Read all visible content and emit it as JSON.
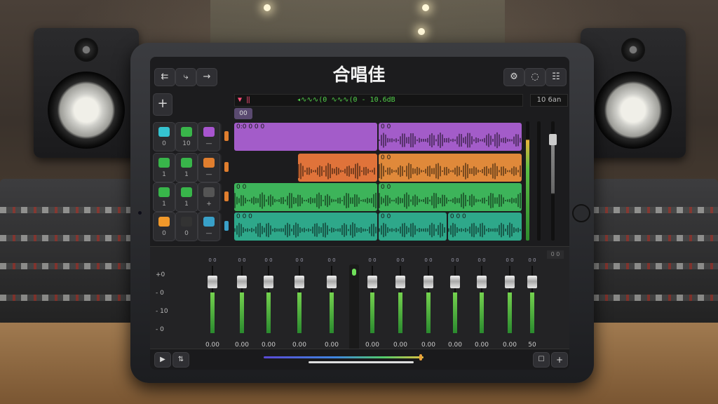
{
  "app": {
    "title": "合唱佳"
  },
  "toolbar": {
    "left": [
      {
        "name": "back-icon",
        "glyph": "⇇"
      },
      {
        "name": "tool-icon",
        "glyph": "⤷"
      },
      {
        "name": "forward-icon",
        "glyph": "→"
      }
    ],
    "right": [
      {
        "name": "gear-icon",
        "glyph": "⚙"
      },
      {
        "name": "loop-icon",
        "glyph": "◌"
      },
      {
        "name": "mixer-icon",
        "glyph": "☷"
      }
    ]
  },
  "transport": {
    "lcd_markers": "▼ ‖",
    "lcd_readout": "◂∿∿∿(0   ∿∿∿(0  - 10.6dB",
    "tempo": "10 6an",
    "marker_label": "00",
    "add_label": "+"
  },
  "tracks": [
    {
      "color": "#b65cd2",
      "ctrls": [
        {
          "c": "#35c3d0",
          "t": "0"
        },
        {
          "c": "#39b54a",
          "t": "10"
        },
        {
          "c": "#a855cf",
          "t": "—"
        }
      ],
      "regions": [
        {
          "label": "0:0 0 0 0",
          "color": "#a35cc9",
          "start": 0,
          "end": 0.5,
          "wave": false
        },
        {
          "label": "0 0",
          "color": "#a35cc9",
          "start": 0.5,
          "end": 1,
          "wave": true
        }
      ]
    },
    {
      "color": "#2a2a2a",
      "ctrls": [
        {
          "c": "#38b54a",
          "t": "1"
        },
        {
          "c": "#38b54a",
          "t": "1"
        },
        {
          "c": "#e07e2e",
          "t": "—"
        }
      ],
      "regions": [
        {
          "label": "",
          "color": "#e0733a",
          "start": 0.22,
          "end": 0.5,
          "wave": true
        },
        {
          "label": "0 0",
          "color": "#e0893a",
          "start": 0.5,
          "end": 1,
          "wave": true
        }
      ]
    },
    {
      "color": "#2a2a2a",
      "ctrls": [
        {
          "c": "#38b54a",
          "t": "1"
        },
        {
          "c": "#38b54a",
          "t": "1"
        },
        {
          "c": "#555",
          "t": "+"
        }
      ],
      "regions": [
        {
          "label": "0 0",
          "color": "#3db45a",
          "start": 0,
          "end": 0.5,
          "wave": true
        },
        {
          "label": "0 0",
          "color": "#3db45a",
          "start": 0.5,
          "end": 1,
          "wave": true
        }
      ]
    },
    {
      "color": "#2a2a2a",
      "ctrls": [
        {
          "c": "#f0982a",
          "t": "0"
        },
        {
          "c": "#333",
          "t": "0"
        },
        {
          "c": "#38a0c8",
          "t": "—"
        }
      ],
      "regions": [
        {
          "label": "0 0 0",
          "color": "#2ea88a",
          "start": 0,
          "end": 0.5,
          "wave": true
        },
        {
          "label": "0 0",
          "color": "#2ea88a",
          "start": 0.5,
          "end": 0.74,
          "wave": true
        },
        {
          "label": "0 0 0",
          "color": "#2ea88a",
          "start": 0.74,
          "end": 1,
          "wave": true
        }
      ]
    }
  ],
  "mixer": {
    "scale": [
      "+0",
      "- 0",
      "- 10",
      "- 0"
    ],
    "faders": [
      {
        "top": "0 0",
        "val": "0.00",
        "pos": 0.15,
        "level": 0.6
      },
      {
        "top": "0 0",
        "val": "0.00",
        "pos": 0.15,
        "level": 0.6
      },
      {
        "top": "0 0",
        "val": "0.00",
        "pos": 0.15,
        "level": 0.6
      },
      {
        "top": "0 0",
        "val": "0.00",
        "pos": 0.15,
        "level": 0.6
      },
      {
        "top": "0 0",
        "val": "0.00",
        "pos": 0.15,
        "level": 0.6
      },
      {
        "top": "0 0",
        "val": "0.00",
        "pos": 0.15,
        "level": 0.6
      },
      {
        "top": "0 0",
        "val": "0.00",
        "pos": 0.15,
        "level": 0.6
      },
      {
        "top": "0 0",
        "val": "0.00",
        "pos": 0.15,
        "level": 0.6
      },
      {
        "top": "0 0",
        "val": "0.00",
        "pos": 0.15,
        "level": 0.6
      },
      {
        "top": "0 0",
        "val": "0.00",
        "pos": 0.15,
        "level": 0.6
      },
      {
        "top": "0 0",
        "val": "0.00",
        "pos": 0.15,
        "level": 0.6
      },
      {
        "top": "0 0",
        "val": "50",
        "pos": 0.15,
        "level": 0.6
      }
    ],
    "corner_label": "0 0"
  },
  "bottom": {
    "play": "▶",
    "loop": "⇅",
    "view": "☐",
    "add": "+"
  }
}
